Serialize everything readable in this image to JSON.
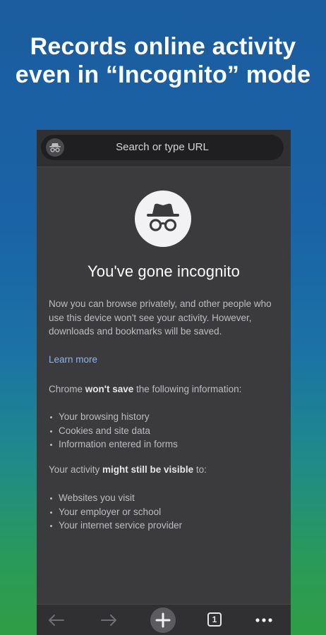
{
  "headline": {
    "line1": "Records online activity",
    "line2": "even in “Incognito” mode"
  },
  "browser": {
    "url_placeholder": "Search or type URL",
    "page": {
      "title": "You've gone incognito",
      "intro": "Now you can browse privately, and other people who use this device won't see your activity. However, downloads and bookmarks will be saved.",
      "learn_more": "Learn more",
      "wont_save": {
        "prefix": "Chrome ",
        "bold": "won't save",
        "suffix": " the following information:",
        "items": [
          "Your browsing history",
          "Cookies and site data",
          "Information entered in forms"
        ]
      },
      "visible": {
        "prefix": "Your activity ",
        "bold": "might still be visible",
        "suffix": " to:",
        "items": [
          "Websites you visit",
          "Your employer or school",
          "Your internet service provider"
        ]
      }
    },
    "toolbar": {
      "tab_count": "1",
      "icons": {
        "back": "back-arrow-icon",
        "forward": "forward-arrow-icon",
        "new_tab": "plus-circle-icon",
        "tabs": "tab-switcher-icon",
        "menu": "more-dots-icon"
      }
    },
    "colors": {
      "background": "#3b3b3d",
      "toolbar": "#303032",
      "link": "#8ab4f8",
      "text": "#bdbdc1"
    }
  }
}
